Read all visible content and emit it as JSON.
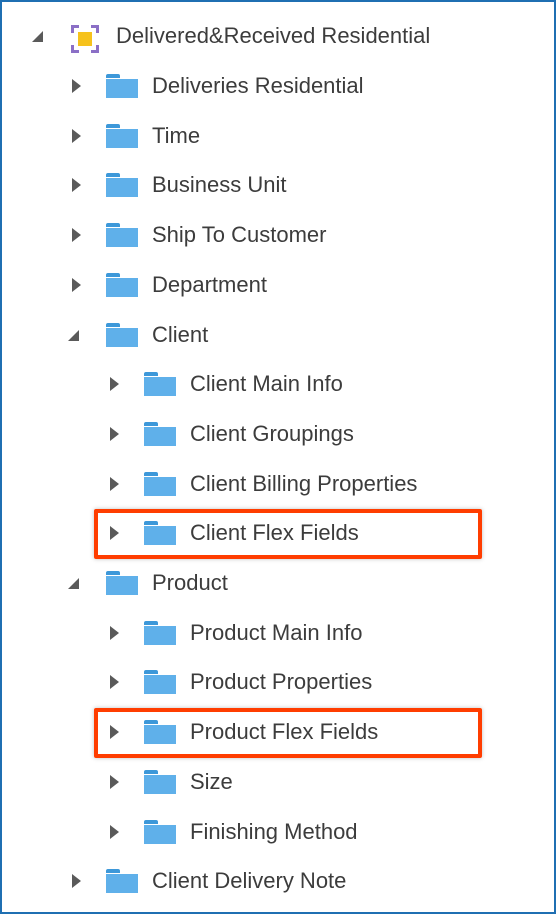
{
  "root": {
    "label": "Delivered&Received Residential"
  },
  "items": [
    {
      "label": "Deliveries Residential",
      "level": 1,
      "expanded": false
    },
    {
      "label": "Time",
      "level": 1,
      "expanded": false
    },
    {
      "label": "Business Unit",
      "level": 1,
      "expanded": false
    },
    {
      "label": "Ship To Customer",
      "level": 1,
      "expanded": false
    },
    {
      "label": "Department",
      "level": 1,
      "expanded": false
    },
    {
      "label": "Client",
      "level": 1,
      "expanded": true
    },
    {
      "label": "Client Main Info",
      "level": 2,
      "expanded": false
    },
    {
      "label": "Client Groupings",
      "level": 2,
      "expanded": false
    },
    {
      "label": "Client Billing Properties",
      "level": 2,
      "expanded": false
    },
    {
      "label": "Client Flex Fields",
      "level": 2,
      "expanded": false,
      "highlighted": true
    },
    {
      "label": "Product",
      "level": 1,
      "expanded": true
    },
    {
      "label": "Product Main Info",
      "level": 2,
      "expanded": false
    },
    {
      "label": "Product Properties",
      "level": 2,
      "expanded": false
    },
    {
      "label": "Product Flex Fields",
      "level": 2,
      "expanded": false,
      "highlighted": true
    },
    {
      "label": "Size",
      "level": 2,
      "expanded": false
    },
    {
      "label": "Finishing Method",
      "level": 2,
      "expanded": false
    },
    {
      "label": "Client Delivery Note",
      "level": 1,
      "expanded": false
    }
  ],
  "colors": {
    "folder": "#5fb0ea",
    "highlight": "#ff3d00",
    "text": "#3c3c3c",
    "caret": "#5a5a5a"
  },
  "icons": {
    "root": "subject-area-icon",
    "node": "folder-icon"
  }
}
